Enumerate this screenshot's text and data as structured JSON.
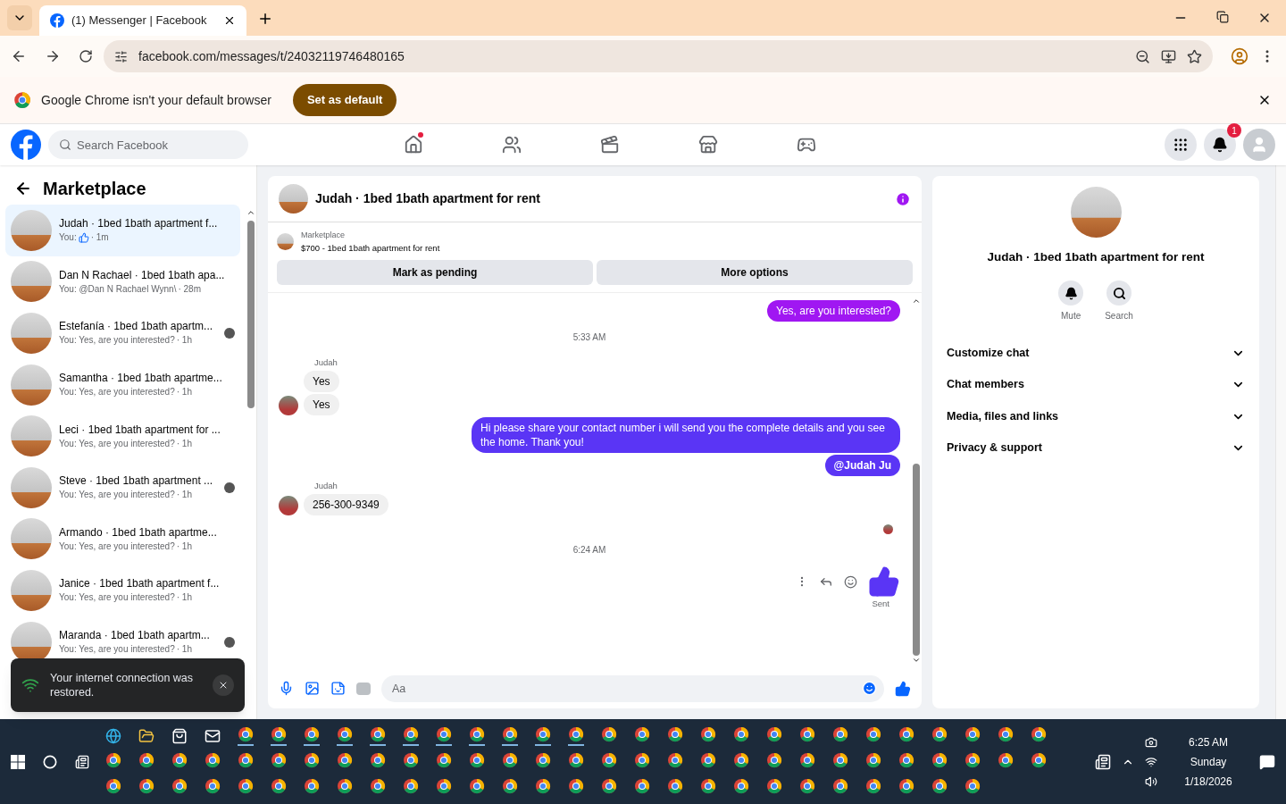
{
  "browser": {
    "tab_title": "(1) Messenger | Facebook",
    "url": "facebook.com/messages/t/24032119746480165",
    "infobar": {
      "text": "Google Chrome isn't your default browser",
      "button": "Set as default"
    }
  },
  "facebook_nav": {
    "search_placeholder": "Search Facebook",
    "tabs": [
      {
        "kind": "home",
        "selected": false,
        "dot": true
      },
      {
        "kind": "friends",
        "selected": false,
        "dot": false
      },
      {
        "kind": "video",
        "selected": false,
        "dot": false
      },
      {
        "kind": "marketplace",
        "selected": false,
        "dot": false
      },
      {
        "kind": "gaming",
        "selected": false,
        "dot": false
      }
    ],
    "notification_count": "1"
  },
  "sidebar": {
    "title": "Marketplace",
    "conversations": [
      {
        "name": "Judah · 1bed 1bath apartment f...",
        "kind": "like",
        "preview": "You:",
        "time": "· 1m",
        "selected": true,
        "seen": false
      },
      {
        "name": "Dan N Rachael · 1bed 1bath apa...",
        "kind": "text",
        "preview": "You: @Dan N Rachael Wynn\\",
        "time": "· 28m",
        "selected": false,
        "seen": false
      },
      {
        "name": "Estefanía · 1bed 1bath apartm...",
        "kind": "text",
        "preview": "You: Yes, are you interested?",
        "time": "· 1h",
        "selected": false,
        "seen": true
      },
      {
        "name": "Samantha · 1bed 1bath apartme...",
        "kind": "text",
        "preview": "You: Yes, are you interested?",
        "time": "· 1h",
        "selected": false,
        "seen": false
      },
      {
        "name": "Leci · 1bed 1bath apartment for ...",
        "kind": "text",
        "preview": "You: Yes, are you interested?",
        "time": "· 1h",
        "selected": false,
        "seen": false
      },
      {
        "name": "Steve · 1bed 1bath apartment ...",
        "kind": "text",
        "preview": "You: Yes, are you interested?",
        "time": "· 1h",
        "selected": false,
        "seen": true
      },
      {
        "name": "Armando · 1bed 1bath apartme...",
        "kind": "text",
        "preview": "You: Yes, are you interested?",
        "time": "· 1h",
        "selected": false,
        "seen": false
      },
      {
        "name": "Janice · 1bed 1bath apartment f...",
        "kind": "text",
        "preview": "You: Yes, are you interested?",
        "time": "· 1h",
        "selected": false,
        "seen": false
      },
      {
        "name": "Maranda · 1bed 1bath apartm...",
        "kind": "text",
        "preview": "You: Yes, are you interested?",
        "time": "· 1h",
        "selected": false,
        "seen": true
      }
    ]
  },
  "toast": {
    "text": "Your internet connection was restored."
  },
  "chat": {
    "title": "Judah · 1bed 1bath apartment for rent",
    "listing": {
      "source": "Marketplace",
      "text": "$700 - 1bed 1bath apartment for rent"
    },
    "buttons": [
      "Mark as pending",
      "More options"
    ],
    "messages": [
      {
        "kind": "outgoing",
        "texts": [
          "Yes, are you interested?"
        ],
        "color": "#a017f2"
      },
      {
        "kind": "timestamp",
        "text": "5:33 AM"
      },
      {
        "kind": "incoming",
        "sender": "Judah",
        "texts": [
          "Yes",
          "Yes"
        ]
      },
      {
        "kind": "outgoing",
        "texts": [
          "Hi please share your contact number i will send you the complete details and you see the home. Thank you!",
          "@Judah Ju"
        ],
        "color": "#5a35f5"
      },
      {
        "kind": "incoming",
        "sender": "Judah",
        "texts": [
          "256-300-9349"
        ]
      },
      {
        "kind": "seen"
      },
      {
        "kind": "timestamp",
        "text": "6:24 AM"
      },
      {
        "kind": "like",
        "status": "Sent"
      }
    ],
    "composer_placeholder": "Aa"
  },
  "details": {
    "title": "Judah · 1bed 1bath apartment for rent",
    "actions": [
      {
        "kind": "mute",
        "label": "Mute"
      },
      {
        "kind": "search",
        "label": "Search"
      }
    ],
    "sections": [
      {
        "label": "Customize chat",
        "expanded": false
      },
      {
        "label": "Chat members",
        "expanded": false
      },
      {
        "label": "Media, files and links",
        "expanded": false
      },
      {
        "label": "Privacy & support",
        "expanded": false
      }
    ]
  },
  "taskbar": {
    "time": "6:25 AM",
    "day": "Sunday",
    "date": "1/18/2026"
  }
}
